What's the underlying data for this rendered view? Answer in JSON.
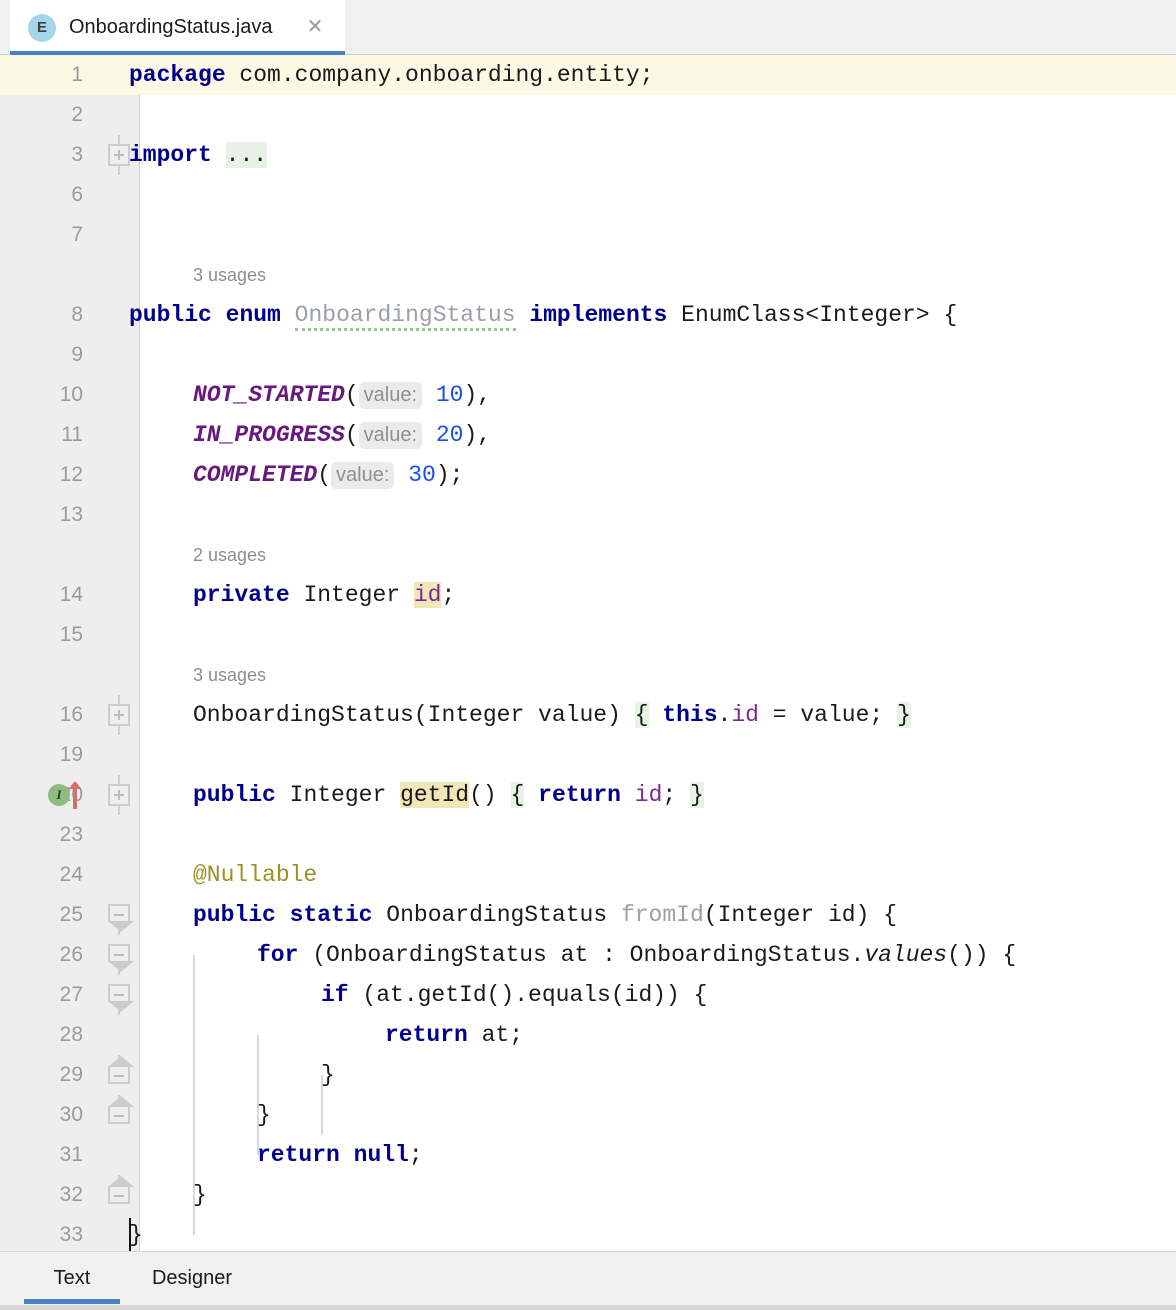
{
  "window": {
    "tab": {
      "icon_letter": "E",
      "icon_name": "java-enum-file-icon",
      "filename": "OnboardingStatus.java",
      "close_label": "✕"
    }
  },
  "colors": {
    "accent": "#4a80c4",
    "keyword": "#00008f",
    "enum_constant": "#67197e",
    "field": "#7a2b8f",
    "number": "#1750eb",
    "annotation": "#9e9022",
    "gray_identifier": "#9aa0a6",
    "current_line_bg": "#fdf8e4",
    "identifier_highlight_bg": "#f0e6b8",
    "brace_highlight_bg": "#e7f3e4",
    "gutter_bg": "#eeeeee",
    "tab_icon_bg": "#a5d5e8",
    "impl_marker_green": "#8fbd7f",
    "override_arrow_red": "#d4706a"
  },
  "editor": {
    "line_numbers": [
      "1",
      "2",
      "3",
      "6",
      "7",
      "8",
      "9",
      "10",
      "11",
      "12",
      "13",
      "14",
      "15",
      "16",
      "19",
      "20",
      "23",
      "24",
      "25",
      "26",
      "27",
      "28",
      "29",
      "30",
      "31",
      "32",
      "33"
    ],
    "usage_hints": [
      {
        "line": "8",
        "text": "3 usages"
      },
      {
        "line": "14",
        "text": "2 usages"
      },
      {
        "line": "16",
        "text": "3 usages"
      }
    ],
    "lines": [
      {
        "no": "1",
        "text": "package com.company.onboarding.entity;"
      },
      {
        "no": "2",
        "text": ""
      },
      {
        "no": "3",
        "text": "import ..."
      },
      {
        "no": "6",
        "text": ""
      },
      {
        "no": "7",
        "text": ""
      },
      {
        "no": "8",
        "text": "public enum OnboardingStatus implements EnumClass<Integer> {"
      },
      {
        "no": "9",
        "text": ""
      },
      {
        "no": "10",
        "text": "    NOT_STARTED( value: 10),"
      },
      {
        "no": "11",
        "text": "    IN_PROGRESS( value: 20),"
      },
      {
        "no": "12",
        "text": "    COMPLETED( value: 30);"
      },
      {
        "no": "13",
        "text": ""
      },
      {
        "no": "14",
        "text": "    private Integer id;"
      },
      {
        "no": "15",
        "text": ""
      },
      {
        "no": "16",
        "text": "    OnboardingStatus(Integer value) { this.id = value; }"
      },
      {
        "no": "19",
        "text": ""
      },
      {
        "no": "20",
        "text": "    public Integer getId() { return id; }"
      },
      {
        "no": "23",
        "text": ""
      },
      {
        "no": "24",
        "text": "    @Nullable"
      },
      {
        "no": "25",
        "text": "    public static OnboardingStatus fromId(Integer id) {"
      },
      {
        "no": "26",
        "text": "        for (OnboardingStatus at : OnboardingStatus.values()) {"
      },
      {
        "no": "27",
        "text": "            if (at.getId().equals(id)) {"
      },
      {
        "no": "28",
        "text": "                return at;"
      },
      {
        "no": "29",
        "text": "            }"
      },
      {
        "no": "30",
        "text": "        }"
      },
      {
        "no": "31",
        "text": "        return null;"
      },
      {
        "no": "32",
        "text": "    }"
      },
      {
        "no": "33",
        "text": "}"
      }
    ],
    "tokens": {
      "kw_package": "package",
      "pkg_name": " com.company.onboarding.entity;",
      "kw_import": "import",
      "import_dots": "...",
      "kw_public": "public",
      "kw_enum": "enum",
      "type_name": "OnboardingStatus",
      "kw_implements": "implements",
      "impl_type": "EnumClass<Integer>",
      "brace_open": "{",
      "brace_close": "}",
      "const1": "NOT_STARTED",
      "const2": "IN_PROGRESS",
      "const3": "COMPLETED",
      "param_hint": "value:",
      "val1": "10",
      "val2": "20",
      "val3": "30",
      "comma": "),",
      "semi_paren": ");",
      "open_paren": "(",
      "kw_private": "private",
      "type_integer": "Integer",
      "field_id": "id",
      "semicolon": ";",
      "ctor_sig": "OnboardingStatus(Integer value)",
      "kw_this": "this",
      "dot": ".",
      "assign": " = value; ",
      "method_getid": "getId",
      "empty_parens": "()",
      "kw_return": "return",
      "annotation_nullable": "@Nullable",
      "kw_static": "static",
      "method_fromid": "fromId",
      "fromid_params": "(Integer id) {",
      "kw_for": "for",
      "for_head": " (OnboardingStatus at : OnboardingStatus.",
      "values_call": "values",
      "for_tail": "()) {",
      "kw_if": "if",
      "if_cond": " (at.getId().equals(id)) {",
      "return_at": " at;",
      "kw_null": "null"
    },
    "gutter_markers": {
      "impl_letter": "I",
      "impl_line": "20",
      "override_arrow_line": "20"
    }
  },
  "bottom_tabs": [
    {
      "label": "Text",
      "active": true
    },
    {
      "label": "Designer",
      "active": false
    }
  ]
}
